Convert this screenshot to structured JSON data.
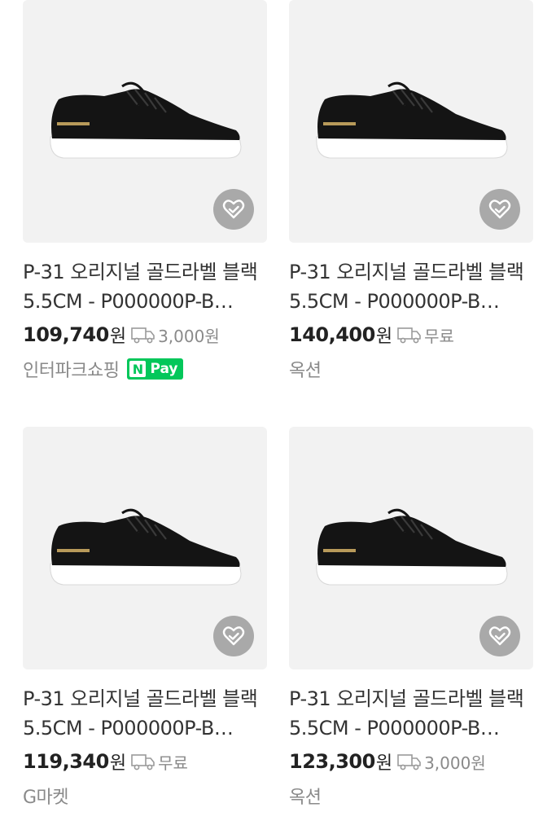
{
  "products": [
    {
      "title": "P-31 오리지널 골드라벨 블랙 5.5CM - P000000P-B…",
      "price": "109,740",
      "currency": "원",
      "shipping": "3,000원",
      "seller": "인터파크쇼핑",
      "npay": {
        "n": "N",
        "label": "Pay"
      }
    },
    {
      "title": "P-31 오리지널 골드라벨 블랙 5.5CM - P000000P-B…",
      "price": "140,400",
      "currency": "원",
      "shipping": "무료",
      "seller": "옥션"
    },
    {
      "title": "P-31 오리지널 골드라벨 블랙 5.5CM - P000000P-B…",
      "price": "119,340",
      "currency": "원",
      "shipping": "무료",
      "seller": "G마켓"
    },
    {
      "title": "P-31 오리지널 골드라벨 블랙 5.5CM - P000000P-B…",
      "price": "123,300",
      "currency": "원",
      "shipping": "3,000원",
      "seller": "옥션"
    }
  ],
  "icons": {
    "wishlist": "heart-check-icon",
    "shipping": "truck-icon"
  },
  "colors": {
    "npay_green": "#03c75a",
    "thumb_bg": "#f2f2f2",
    "wish_bg": "#a9a9a9"
  }
}
